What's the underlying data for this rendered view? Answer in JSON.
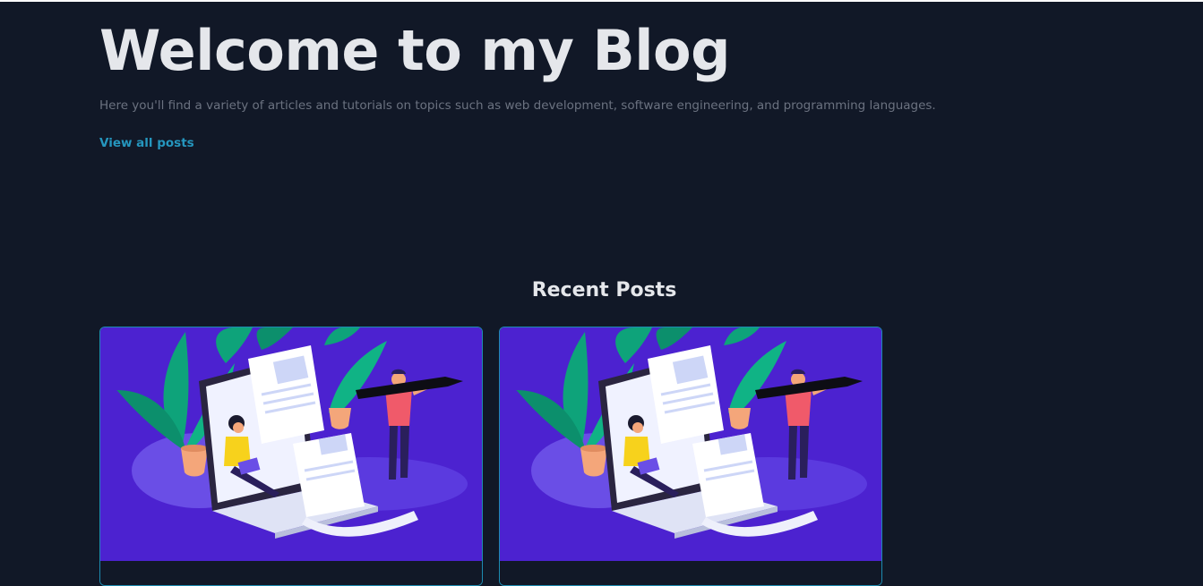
{
  "hero": {
    "title": "Welcome to my Blog",
    "subtitle": "Here you'll find a variety of articles and tutorials on topics such as web development, software engineering, and programming languages.",
    "view_all_label": "View all posts"
  },
  "recent": {
    "heading": "Recent Posts",
    "posts": [
      {
        "image_icon": "blog-writing-illustration"
      },
      {
        "image_icon": "blog-writing-illustration"
      }
    ]
  },
  "colors": {
    "background": "#111827",
    "accent_link": "#2596be",
    "card_border": "#1d8bb0",
    "illustration_bg": "#4c22d0"
  }
}
